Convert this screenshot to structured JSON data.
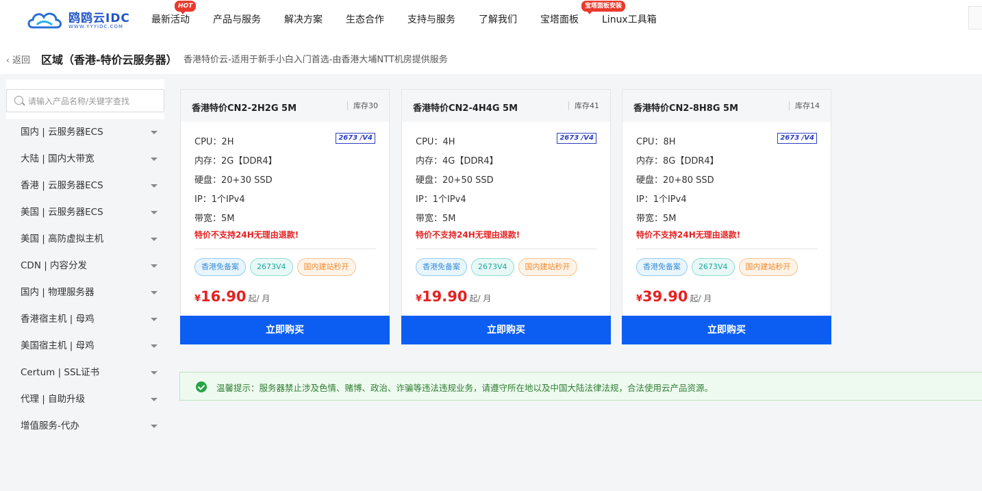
{
  "header": {
    "logo_text": "鸥鸥云IDC",
    "logo_sub": "WWW.YYYIDC.COM",
    "nav": [
      {
        "label": "最新活动",
        "badge": "HOT"
      },
      {
        "label": "产品与服务",
        "badge": ""
      },
      {
        "label": "解决方案",
        "badge": ""
      },
      {
        "label": "生态合作",
        "badge": ""
      },
      {
        "label": "支持与服务",
        "badge": ""
      },
      {
        "label": "了解我们",
        "badge": ""
      },
      {
        "label": "宝塔面板",
        "badge": "宝塔面板安装"
      },
      {
        "label": "Linux工具箱",
        "badge": ""
      }
    ]
  },
  "breadcrumb": {
    "back": "返回",
    "title": "区域（香港-特价云服务器）",
    "desc": "香港特价云-适用于新手小白入门首选-由香港大埔NTT机房提供服务"
  },
  "sidebar": {
    "search_placeholder": "请输入产品名称/关键字查找",
    "items": [
      "国内 | 云服务器ECS",
      "大陆 | 国内大带宽",
      "香港 | 云服务器ECS",
      "美国 | 云服务器ECS",
      "美国 | 高防虚拟主机",
      "CDN | 内容分发",
      "国内 | 物理服务器",
      "香港宿主机 | 母鸡",
      "美国宿主机 | 母鸡",
      "Certum | SSL证书",
      "代理 | 自助升级",
      "增值服务-代办"
    ]
  },
  "products": [
    {
      "title": "香港特价CN2-2H2G 5M",
      "stock": "库存30",
      "cpu_label": "CPU：",
      "cpu": "2H",
      "cpu_badge": "2673 /V4",
      "mem_label": "内存：",
      "mem": "2G【DDR4】",
      "disk_label": "硬盘：",
      "disk": "20+30 SSD",
      "ip_label": "IP：",
      "ip": "1个IPv4",
      "bw_label": "带宽：",
      "bw": "5M",
      "warning": "特价不支持24H无理由退款!",
      "tags": [
        "香港免备案",
        "2673V4",
        "国内建站秒开"
      ],
      "currency": "¥",
      "price": "16.90",
      "unit": "起/ 月",
      "buy": "立即购买"
    },
    {
      "title": "香港特价CN2-4H4G 5M",
      "stock": "库存41",
      "cpu_label": "CPU：",
      "cpu": "4H",
      "cpu_badge": "2673 /V4",
      "mem_label": "内存：",
      "mem": "4G【DDR4】",
      "disk_label": "硬盘：",
      "disk": "20+50 SSD",
      "ip_label": "IP：",
      "ip": "1个IPv4",
      "bw_label": "带宽：",
      "bw": "5M",
      "warning": "特价不支持24H无理由退款!",
      "tags": [
        "香港免备案",
        "2673V4",
        "国内建站秒开"
      ],
      "currency": "¥",
      "price": "19.90",
      "unit": "起/ 月",
      "buy": "立即购买"
    },
    {
      "title": "香港特价CN2-8H8G 5M",
      "stock": "库存14",
      "cpu_label": "CPU：",
      "cpu": "8H",
      "cpu_badge": "2673 /V4",
      "mem_label": "内存：",
      "mem": "8G【DDR4】",
      "disk_label": "硬盘：",
      "disk": "20+80 SSD",
      "ip_label": "IP：",
      "ip": "1个IPv4",
      "bw_label": "带宽：",
      "bw": "5M",
      "warning": "特价不支持24H无理由退款!",
      "tags": [
        "香港免备案",
        "2673V4",
        "国内建站秒开"
      ],
      "currency": "¥",
      "price": "39.90",
      "unit": "起/ 月",
      "buy": "立即购买"
    }
  ],
  "notice": "温馨提示：服务器禁止涉及色情、赌博、政治、诈骗等违法违规业务，请遵守所在地以及中国大陆法律法规，合法使用云产品资源。",
  "colors": {
    "accent": "#0c5ef3",
    "price": "#e52222",
    "notice_green": "#26a445"
  }
}
